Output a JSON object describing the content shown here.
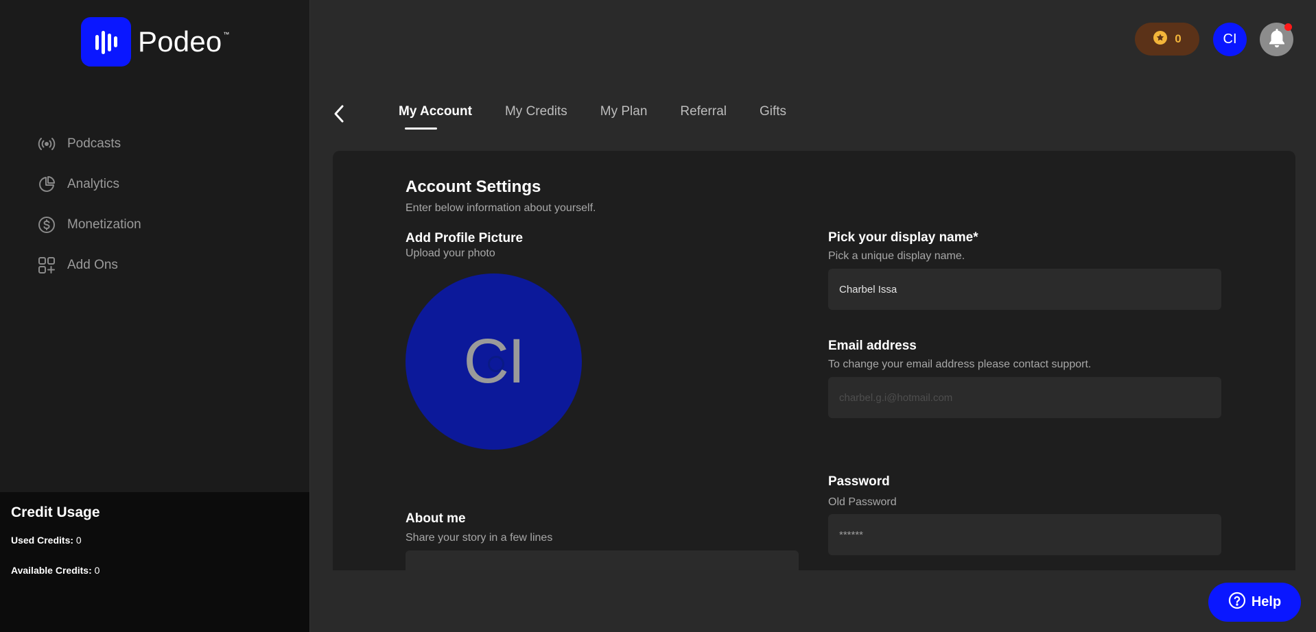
{
  "brand": {
    "name": "Podeo",
    "tm": "™"
  },
  "sidebar": {
    "items": [
      {
        "label": "Podcasts",
        "icon": "broadcast-icon"
      },
      {
        "label": "Analytics",
        "icon": "pie-chart-icon"
      },
      {
        "label": "Monetization",
        "icon": "dollar-circle-icon"
      },
      {
        "label": "Add Ons",
        "icon": "grid-plus-icon"
      }
    ],
    "credit_usage": {
      "title": "Credit Usage",
      "used_label": "Used Credits:",
      "used_value": "0",
      "available_label": "Available Credits:",
      "available_value": "0"
    }
  },
  "header": {
    "credits_count": "0",
    "avatar_initials": "CI",
    "accent": "#0a17ff"
  },
  "tabs": [
    {
      "label": "My Account",
      "active": true
    },
    {
      "label": "My Credits"
    },
    {
      "label": "My Plan"
    },
    {
      "label": "Referral"
    },
    {
      "label": "Gifts"
    }
  ],
  "account": {
    "title": "Account Settings",
    "subtitle": "Enter below information about yourself.",
    "profile": {
      "label": "Add Profile Picture",
      "sublabel": "Upload your photo",
      "initials": "CI"
    },
    "display_name": {
      "label": "Pick your display name*",
      "sublabel": "Pick a unique display name.",
      "value": "Charbel Issa"
    },
    "email": {
      "label": "Email address",
      "sublabel": "To change your email address please contact support.",
      "placeholder": "charbel.g.i@hotmail.com"
    },
    "password": {
      "label": "Password",
      "sublabel": "Old Password",
      "placeholder": "******"
    },
    "about": {
      "label": "About me",
      "sublabel": "Share your story in a few lines"
    }
  },
  "help": {
    "label": "Help"
  }
}
